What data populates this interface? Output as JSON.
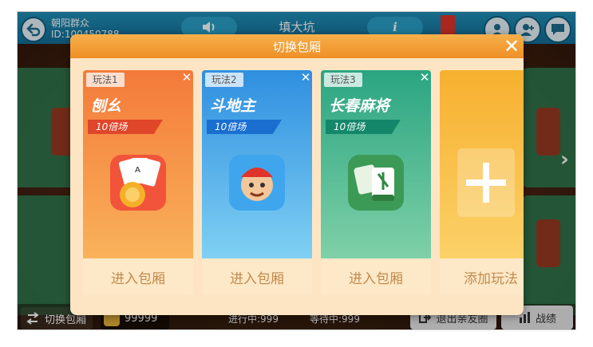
{
  "topbar": {
    "user_name": "朝阳群众",
    "user_id": "ID:100450788",
    "room_title": "填大坑",
    "speaker_icon": "speaker-icon",
    "info_icon": "info-icon"
  },
  "dialog": {
    "title": "切换包厢",
    "close": "✕",
    "cards": [
      {
        "tag": "玩法1",
        "name": "刨幺",
        "multiplier": "10倍场",
        "action": "进入包厢",
        "close": "✕",
        "color_top": "#f47a3a",
        "color_bottom": "#f9b25a",
        "icon": "poker-cards-icon"
      },
      {
        "tag": "玩法2",
        "name": "斗地主",
        "multiplier": "10倍场",
        "action": "进入包厢",
        "close": "✕",
        "color_top": "#2f8fe0",
        "color_bottom": "#7fd0f3",
        "icon": "landlord-character-icon"
      },
      {
        "tag": "玩法3",
        "name": "长春麻将",
        "multiplier": "10倍场",
        "action": "进入包厢",
        "close": "✕",
        "color_top": "#2aa581",
        "color_bottom": "#7fd0a8",
        "icon": "mahjong-tile-icon"
      },
      {
        "action": "添加玩法",
        "color_top": "#f7b02f",
        "color_bottom": "#fbd168",
        "icon": "plus-icon"
      }
    ]
  },
  "bottombar": {
    "switch_label": "切换包厢",
    "coins": "99999",
    "in_progress": "进行中:999",
    "waiting": "等待中:999",
    "exit_label": "退出亲友圈",
    "record_label": "战绩"
  }
}
